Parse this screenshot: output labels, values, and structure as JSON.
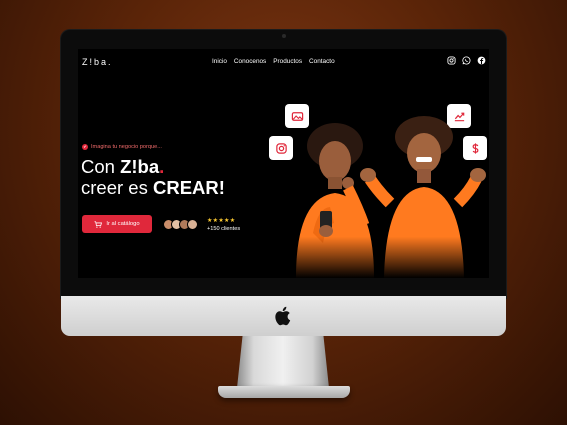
{
  "site": {
    "logo": "Z!ba.",
    "nav": [
      "Inicio",
      "Conocenos",
      "Productos",
      "Contacto"
    ],
    "social_icons": [
      "instagram-icon",
      "whatsapp-icon",
      "facebook-icon"
    ],
    "hero": {
      "tagline": "Imagina tu negocio porque...",
      "headline_prefix": "Con ",
      "headline_brand": "Z!ba",
      "headline_dot": ".",
      "headline_line2_prefix": "creer es ",
      "headline_line2_bold": "CREAR!",
      "cta_label": "Ir al catálogo",
      "stars": "★★★★★",
      "clients_label": "+150 clientes"
    },
    "floating_icons": [
      "photo-icon",
      "instagram-icon",
      "chart-up-icon",
      "dollar-icon"
    ]
  },
  "colors": {
    "accent": "#e0283b",
    "background": "#000000",
    "star": "#ffcc33",
    "backdrop": "#6b2c0f"
  }
}
